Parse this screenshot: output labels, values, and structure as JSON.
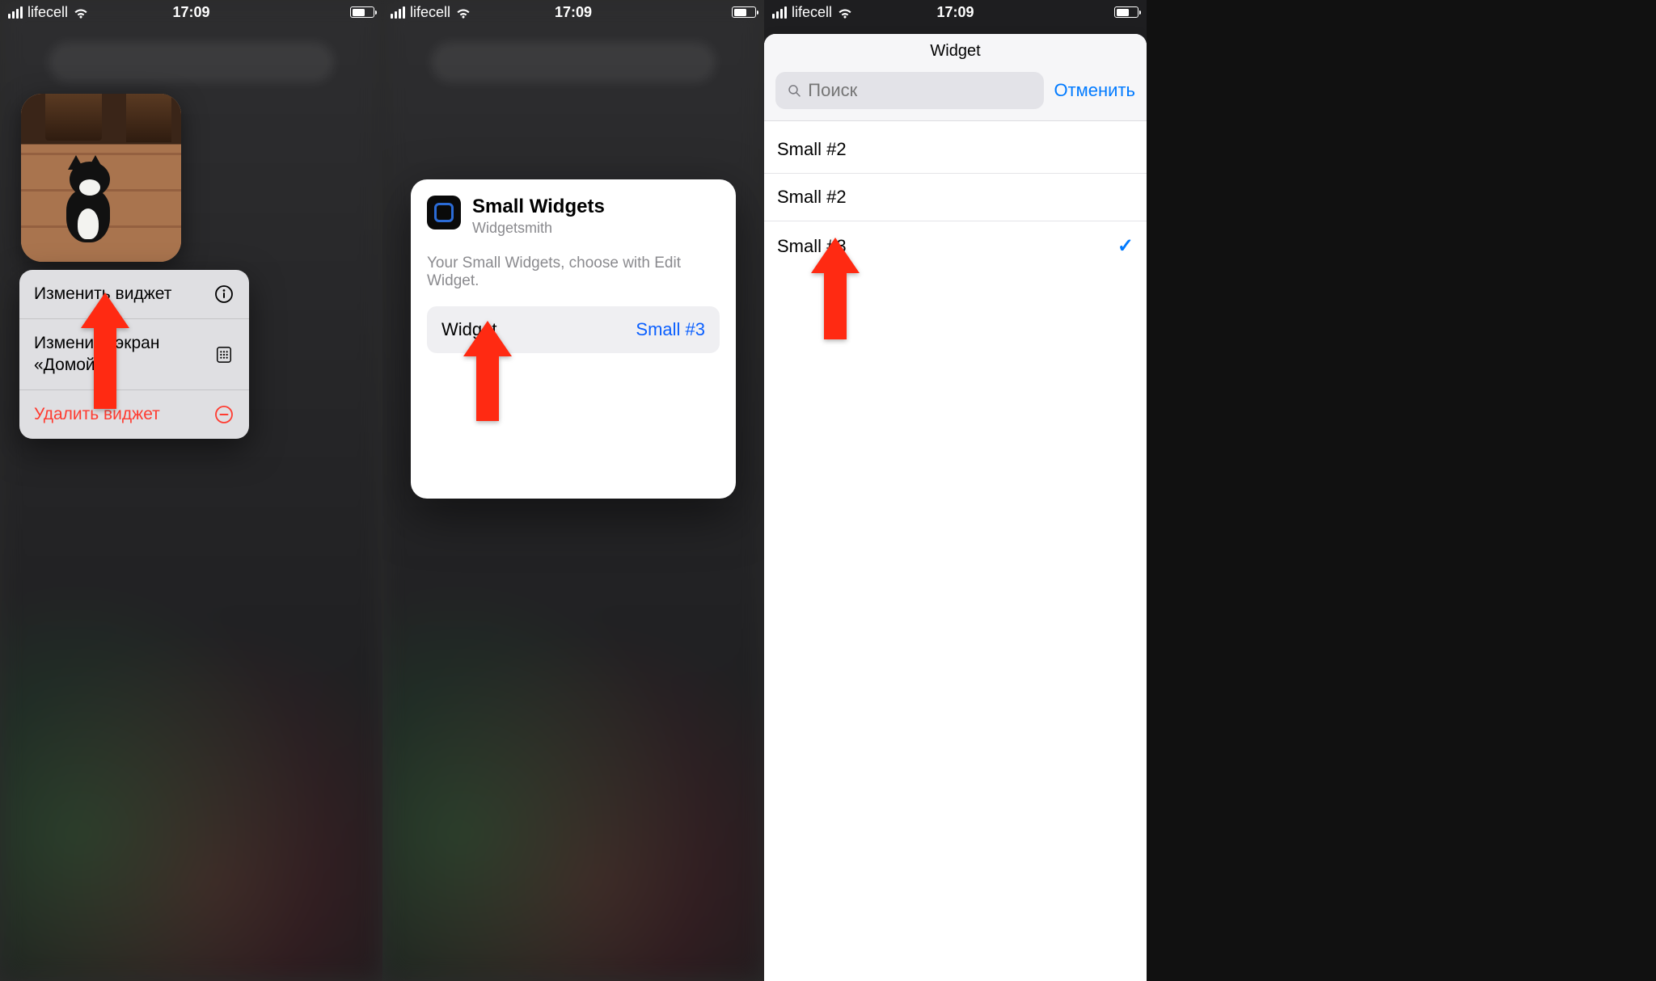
{
  "statusbar": {
    "carrier": "lifecell",
    "time": "17:09"
  },
  "panel1": {
    "menu": {
      "edit_widget": "Изменить виджет",
      "edit_home": "Изменить экран «Домой»",
      "remove_widget": "Удалить виджет"
    }
  },
  "panel2": {
    "title": "Small Widgets",
    "subtitle": "Widgetsmith",
    "description": "Your Small Widgets, choose with Edit Widget.",
    "row_label": "Widget",
    "row_value": "Small #3"
  },
  "panel3": {
    "sheet_title": "Widget",
    "search_placeholder": "Поиск",
    "cancel": "Отменить",
    "options": [
      {
        "label": "Small #2",
        "selected": false
      },
      {
        "label": "Small #2",
        "selected": false
      },
      {
        "label": "Small #3",
        "selected": true
      }
    ]
  }
}
